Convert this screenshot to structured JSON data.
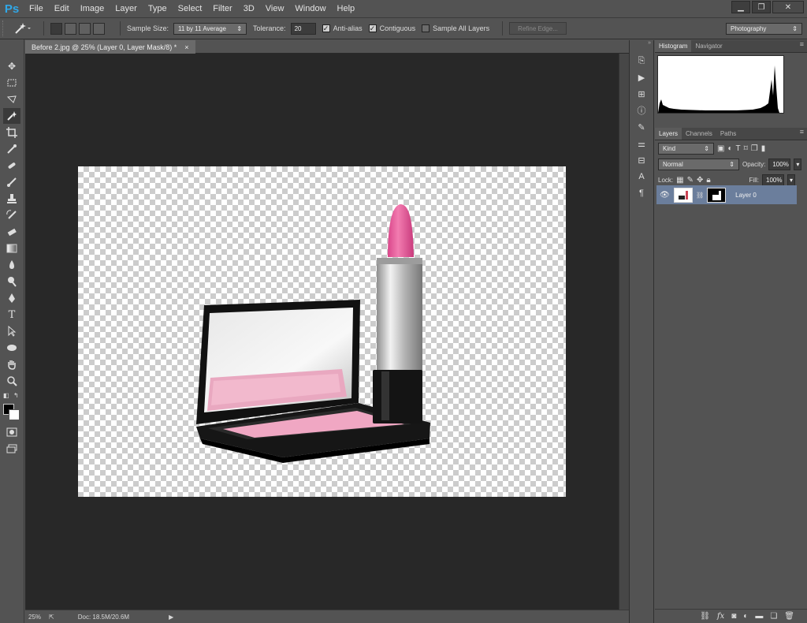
{
  "app": {
    "logo": "Ps"
  },
  "menu": [
    "File",
    "Edit",
    "Image",
    "Layer",
    "Type",
    "Select",
    "Filter",
    "3D",
    "View",
    "Window",
    "Help"
  ],
  "window_controls": {
    "minimize": "▁",
    "restore": "❐",
    "close": "✕"
  },
  "options": {
    "sample_size_label": "Sample Size:",
    "sample_size_value": "11 by 11 Average",
    "tolerance_label": "Tolerance:",
    "tolerance_value": "20",
    "anti_alias_label": "Anti-alias",
    "anti_alias_checked": true,
    "contiguous_label": "Contiguous",
    "contiguous_checked": true,
    "sample_all_layers_label": "Sample All Layers",
    "sample_all_layers_checked": false,
    "refine_edge_label": "Refine Edge...",
    "workspace_value": "Photography"
  },
  "document": {
    "tab_title": "Before 2.jpg @ 25% (Layer 0, Layer Mask/8) *",
    "close": "×"
  },
  "status": {
    "zoom": "25%",
    "doc_info": "Doc: 18.5M/20.6M"
  },
  "histogram_panel": {
    "tabs": [
      "Histogram",
      "Navigator"
    ]
  },
  "layers_panel": {
    "tabs": [
      "Layers",
      "Channels",
      "Paths"
    ],
    "kind_filter": "Kind",
    "blend_mode": "Normal",
    "opacity_label": "Opacity:",
    "opacity_value": "100%",
    "lock_label": "Lock:",
    "fill_label": "Fill:",
    "fill_value": "100%",
    "layers": [
      {
        "name": "Layer 0",
        "visible": true,
        "selected": true
      }
    ],
    "footer_icons": [
      "link-icon",
      "fx-icon",
      "mask-icon",
      "adjustment-icon",
      "group-icon",
      "new-layer-icon",
      "trash-icon"
    ],
    "fx_text": "fx"
  },
  "colors": {
    "accent": "#30a8e8",
    "selection": "#6b7e9c",
    "canvas_bg": "#282828",
    "lipstick": "#e8629f"
  }
}
